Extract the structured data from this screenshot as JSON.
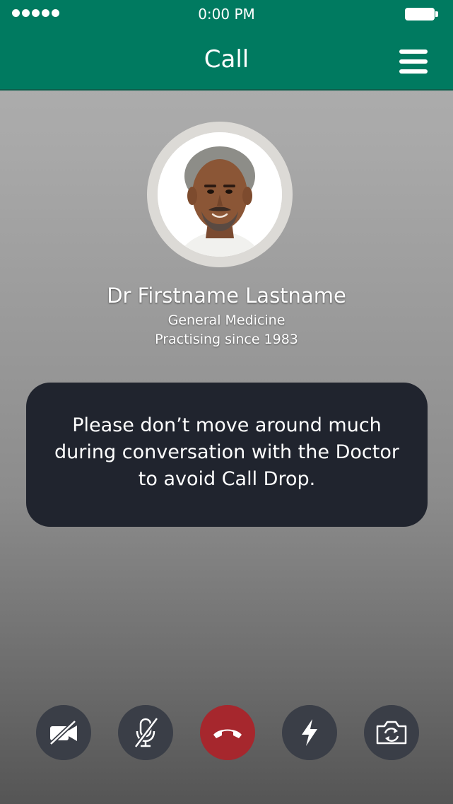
{
  "status_bar": {
    "time": "0:00 PM",
    "signal_dots": 5
  },
  "header": {
    "title": "Call",
    "menu_icon": "hamburger-menu-icon",
    "background_color": "#007a60"
  },
  "doctor": {
    "name": "Dr Firstname Lastname",
    "specialty": "General Medicine",
    "practising_since": "Practising since 1983"
  },
  "notice": {
    "text": "Please don’t move around much during conversation with the Doctor to avoid Call Drop."
  },
  "controls": [
    {
      "icon": "video-off-icon"
    },
    {
      "icon": "mic-off-icon"
    },
    {
      "icon": "end-call-icon",
      "color": "#a6272d"
    },
    {
      "icon": "flash-icon"
    },
    {
      "icon": "switch-camera-icon"
    }
  ]
}
